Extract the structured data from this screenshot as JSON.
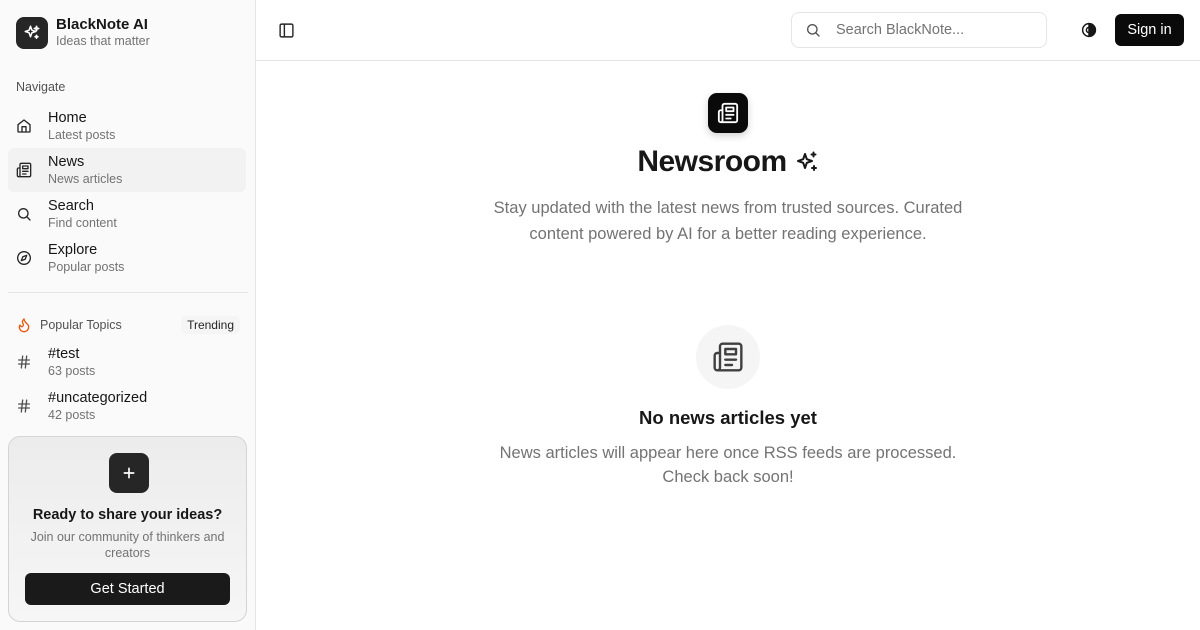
{
  "brand": {
    "name": "BlackNote AI",
    "tagline": "Ideas that matter",
    "logo_icon": "sparkles-icon"
  },
  "sidebar": {
    "navigate_label": "Navigate",
    "nav_items": [
      {
        "title": "Home",
        "subtitle": "Latest posts",
        "icon": "home-icon",
        "active": false
      },
      {
        "title": "News",
        "subtitle": "News articles",
        "icon": "newspaper-icon",
        "active": true
      },
      {
        "title": "Search",
        "subtitle": "Find content",
        "icon": "search-icon",
        "active": false
      },
      {
        "title": "Explore",
        "subtitle": "Popular posts",
        "icon": "compass-icon",
        "active": false
      }
    ],
    "topics_label": "Popular Topics",
    "trending_badge": "Trending",
    "topics": [
      {
        "tag": "#test",
        "count": "63 posts"
      },
      {
        "tag": "#uncategorized",
        "count": "42 posts"
      }
    ],
    "cta": {
      "title": "Ready to share your ideas?",
      "subtitle": "Join our community of thinkers and creators",
      "button_label": "Get Started"
    }
  },
  "header": {
    "search_placeholder": "Search BlackNote...",
    "signin_label": "Sign in"
  },
  "main": {
    "title": "Newsroom",
    "description": "Stay updated with the latest news from trusted sources. Curated content powered by AI for a better reading experience.",
    "empty_title": "No news articles yet",
    "empty_description": "News articles will appear here once RSS feeds are processed. Check back soon!"
  },
  "colors": {
    "accent": "#0a0a0a",
    "sidebar_bg": "#fafafa",
    "flame": "#ea580c",
    "muted_text": "#737373"
  }
}
